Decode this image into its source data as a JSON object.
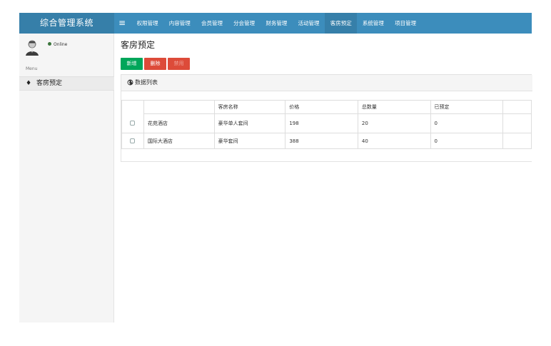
{
  "app": {
    "title": "综合管理系统"
  },
  "topnav": {
    "menu_icon": "≡",
    "items": [
      "权限管理",
      "内容管理",
      "会员管理",
      "分会管理",
      "财务管理",
      "活动管理",
      "客房预定",
      "系统管理",
      "项目管理"
    ],
    "active_index": 6
  },
  "sidebar": {
    "status": "Online",
    "menu_header": "Menu",
    "item": {
      "icon": "diamond-icon",
      "glyph": "♦",
      "label": "客房预定"
    }
  },
  "page": {
    "title": "客房预定",
    "buttons": {
      "add": "新增",
      "delete": "删除",
      "third": "禁用"
    },
    "panel_title": "数据列表"
  },
  "table": {
    "columns": [
      "",
      "客房名称",
      "价格",
      "总数量",
      "已预定"
    ],
    "rows": [
      {
        "name": "花苑酒店",
        "room": "豪华单人套间",
        "price": "198",
        "total": "20",
        "booked": "0"
      },
      {
        "name": "国际大酒店",
        "room": "豪华套间",
        "price": "388",
        "total": "40",
        "booked": "0"
      }
    ]
  },
  "colors": {
    "navbar": "#3c8dbc",
    "brand": "#367fa9",
    "add": "#00a65a",
    "delete": "#dd4b39",
    "online": "#3c763d"
  }
}
